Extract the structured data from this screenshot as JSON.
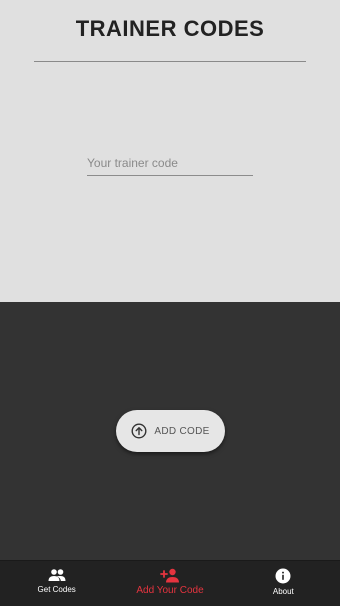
{
  "header": {
    "title": "TRAINER CODES"
  },
  "form": {
    "code_placeholder": "Your trainer code",
    "code_value": ""
  },
  "actions": {
    "add_code_label": "ADD CODE"
  },
  "bottom_nav": {
    "items": [
      {
        "label": "Get Codes",
        "icon": "people-icon",
        "active": false
      },
      {
        "label": "Add Your Code",
        "icon": "add-person-icon",
        "active": true
      },
      {
        "label": "About",
        "icon": "info-icon",
        "active": false
      }
    ]
  },
  "colors": {
    "top_background": "#e0e0e0",
    "bottom_background": "#333333",
    "nav_background": "#222222",
    "accent": "#e5343f"
  }
}
